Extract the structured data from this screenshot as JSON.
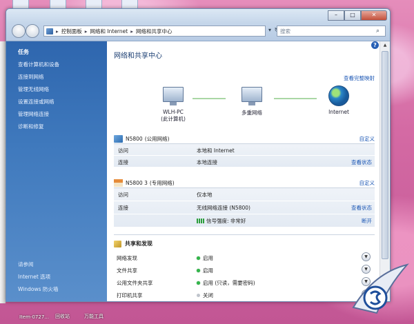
{
  "window": {
    "breadcrumb": [
      "控制面板",
      "网络和 Internet",
      "网络和共享中心"
    ],
    "search_placeholder": "搜索",
    "controls": {
      "minimize": "–",
      "maximize": "□",
      "close": "✕"
    }
  },
  "sidebar": {
    "tasks_heading": "任务",
    "tasks": [
      "查看计算机和设备",
      "连接到网络",
      "管理无线网络",
      "设置连接或网络",
      "管理网络连接",
      "诊断和修复"
    ],
    "see_also_heading": "请参阅",
    "see_also": [
      "Internet 选项",
      "Windows 防火墙"
    ]
  },
  "main": {
    "title": "网络和共享中心",
    "view_full_map": "查看完整映射",
    "nodes": [
      {
        "name": "WLH-PC",
        "sub": "(此计算机)"
      },
      {
        "name": "多重网络",
        "sub": ""
      },
      {
        "name": "Internet",
        "sub": ""
      }
    ],
    "networks": [
      {
        "name": "N5800",
        "type": "(公用网络)",
        "customize": "自定义",
        "rows": [
          {
            "key": "访问",
            "value": "本地和 Internet",
            "action": ""
          },
          {
            "key": "连接",
            "value": "本地连接",
            "action": "查看状态"
          }
        ]
      },
      {
        "name": "N5800  3",
        "type": "(专用网络)",
        "customize": "自定义",
        "rows": [
          {
            "key": "访问",
            "value": "仅本地",
            "action": ""
          },
          {
            "key": "连接",
            "value": "无线网络连接 (N5800)",
            "action": "查看状态"
          },
          {
            "key": "",
            "value": "信号强度: 非常好",
            "action": "断开"
          }
        ]
      }
    ],
    "sharing": {
      "heading": "共享和发现",
      "items": [
        {
          "name": "网络发现",
          "status": "启用",
          "on": true
        },
        {
          "name": "文件共享",
          "status": "启用",
          "on": true
        },
        {
          "name": "公用文件夹共享",
          "status": "启用 (只读，需要密码)",
          "on": true
        },
        {
          "name": "打印机共享",
          "status": "关闭",
          "on": false
        }
      ]
    }
  },
  "taskbar": [
    "Item-0727...",
    "回收站",
    "万能工具"
  ]
}
